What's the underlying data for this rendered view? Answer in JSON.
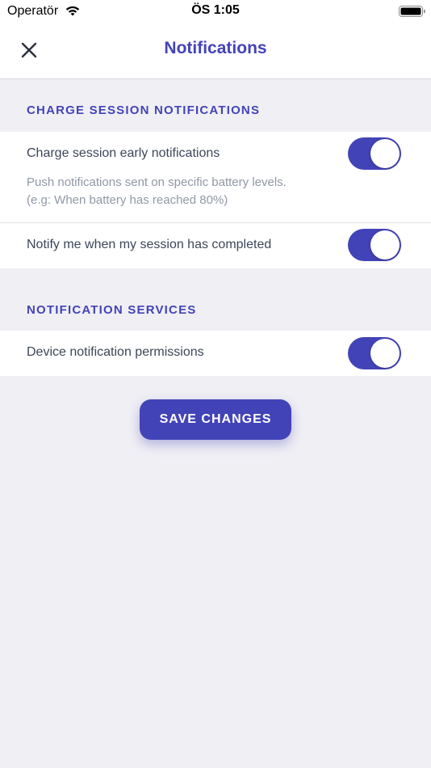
{
  "status_bar": {
    "carrier": "Operatör",
    "time": "ÖS 1:05"
  },
  "nav": {
    "title": "Notifications",
    "close_icon": "close-icon"
  },
  "sections": [
    {
      "header": "CHARGE SESSION NOTIFICATIONS",
      "rows": [
        {
          "label": "Charge session early notifications",
          "description_line1": "Push notifications sent on specific battery levels.",
          "description_line2": "(e.g: When battery has reached 80%)",
          "enabled": true
        },
        {
          "label": "Notify me when my session has completed",
          "enabled": true
        }
      ]
    },
    {
      "header": "NOTIFICATION SERVICES",
      "rows": [
        {
          "label": "Device notification permissions",
          "enabled": true
        }
      ]
    }
  ],
  "save_button": "SAVE CHANGES",
  "colors": {
    "accent": "#4343b8",
    "background": "#f0eff4",
    "label": "#3d4658",
    "description": "#9198a6"
  }
}
